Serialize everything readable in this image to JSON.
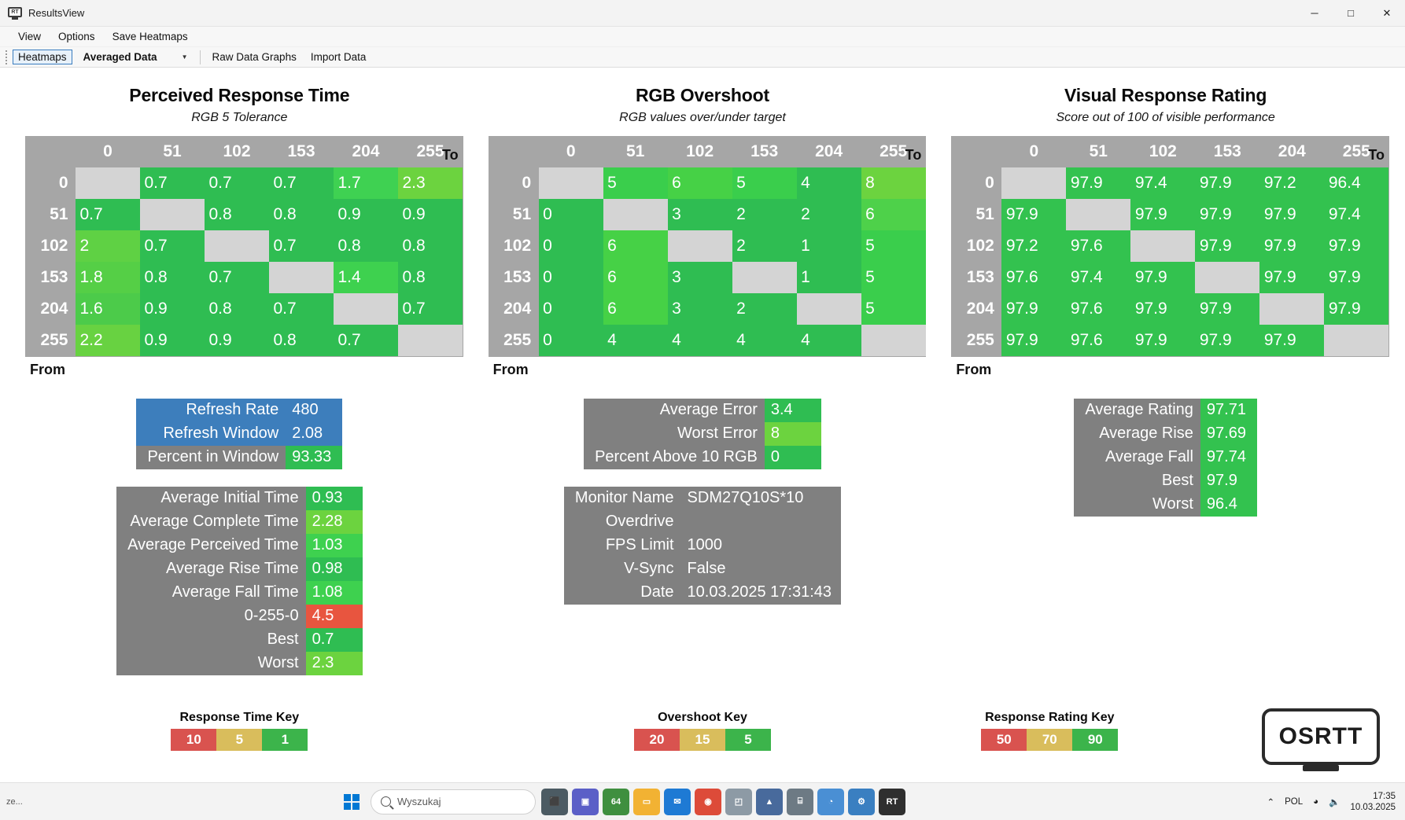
{
  "window": {
    "title": "ResultsView",
    "icon": "monitor-rt-icon",
    "minimize": "─",
    "maximize": "□",
    "close": "✕"
  },
  "menubar": {
    "items": [
      {
        "label": "View"
      },
      {
        "label": "Options"
      },
      {
        "label": "Save Heatmaps"
      }
    ]
  },
  "toolbar": {
    "heatmaps_label": "Heatmaps",
    "dataset_selected": "Averaged Data",
    "dataset_caret": "▼",
    "raw_data_graphs_label": "Raw Data Graphs",
    "import_data_label": "Import Data"
  },
  "axis": {
    "to": "To",
    "from": "From"
  },
  "chart_data": [
    {
      "type": "heatmap",
      "title": "Perceived Response Time",
      "subtitle": "RGB 5 Tolerance",
      "xlabel": "To",
      "ylabel": "From",
      "categories": [
        "0",
        "51",
        "102",
        "153",
        "204",
        "255"
      ],
      "rows": [
        "0",
        "51",
        "102",
        "153",
        "204",
        "255"
      ],
      "values": [
        [
          null,
          "0.7",
          "0.7",
          "0.7",
          "1.7",
          "2.3"
        ],
        [
          "0.7",
          null,
          "0.8",
          "0.8",
          "0.9",
          "0.9"
        ],
        [
          "2",
          "0.7",
          null,
          "0.7",
          "0.8",
          "0.8"
        ],
        [
          "1.8",
          "0.8",
          "0.7",
          null,
          "1.4",
          "0.8"
        ],
        [
          "1.6",
          "0.9",
          "0.8",
          "0.7",
          null,
          "0.7"
        ],
        [
          "2.2",
          "0.9",
          "0.9",
          "0.8",
          "0.7",
          null
        ]
      ],
      "colors": [
        [
          null,
          "#2fbd52",
          "#2fbd52",
          "#2fbd52",
          "#3fd152",
          "#6cd33f"
        ],
        [
          "#2fbd52",
          null,
          "#2fbd52",
          "#2fbd52",
          "#2fbd52",
          "#2fbd52"
        ],
        [
          "#5fd144",
          "#2fbd52",
          null,
          "#2fbd52",
          "#2fbd52",
          "#2fbd52"
        ],
        [
          "#55cf46",
          "#2fbd52",
          "#2fbd52",
          null,
          "#3ed14f",
          "#2fbd52"
        ],
        [
          "#4ccb4a",
          "#2fbd52",
          "#2fbd52",
          "#2fbd52",
          null,
          "#2fbd52"
        ],
        [
          "#68d241",
          "#2fbd52",
          "#2fbd52",
          "#2fbd52",
          "#2fbd52",
          null
        ]
      ]
    },
    {
      "type": "heatmap",
      "title": "RGB Overshoot",
      "subtitle": "RGB values over/under target",
      "xlabel": "To",
      "ylabel": "From",
      "categories": [
        "0",
        "51",
        "102",
        "153",
        "204",
        "255"
      ],
      "rows": [
        "0",
        "51",
        "102",
        "153",
        "204",
        "255"
      ],
      "values": [
        [
          null,
          "5",
          "6",
          "5",
          "4",
          "8"
        ],
        [
          "0",
          null,
          "3",
          "2",
          "2",
          "6"
        ],
        [
          "0",
          "6",
          null,
          "2",
          "1",
          "5"
        ],
        [
          "0",
          "6",
          "3",
          null,
          "1",
          "5"
        ],
        [
          "0",
          "6",
          "3",
          "2",
          null,
          "5"
        ],
        [
          "0",
          "4",
          "4",
          "4",
          "4",
          null
        ]
      ],
      "colors": [
        [
          null,
          "#3ace4c",
          "#46d146",
          "#3ace4c",
          "#2fbd52",
          "#6cd33f"
        ],
        [
          "#2fbd52",
          null,
          "#2fbd52",
          "#2fbd52",
          "#2fbd52",
          "#4ed14a"
        ],
        [
          "#2fbd52",
          "#46d146",
          null,
          "#2fbd52",
          "#2fbd52",
          "#3ace4c"
        ],
        [
          "#2fbd52",
          "#46d146",
          "#2fbd52",
          null,
          "#2fbd52",
          "#3ace4c"
        ],
        [
          "#2fbd52",
          "#46d146",
          "#2fbd52",
          "#2fbd52",
          null,
          "#3ace4c"
        ],
        [
          "#2fbd52",
          "#2fbd52",
          "#2fbd52",
          "#2fbd52",
          "#2fbd52",
          null
        ]
      ]
    },
    {
      "type": "heatmap",
      "title": "Visual Response Rating",
      "subtitle": "Score out of 100 of visible performance",
      "xlabel": "To",
      "ylabel": "From",
      "categories": [
        "0",
        "51",
        "102",
        "153",
        "204",
        "255"
      ],
      "rows": [
        "0",
        "51",
        "102",
        "153",
        "204",
        "255"
      ],
      "values": [
        [
          null,
          "97.9",
          "97.4",
          "97.9",
          "97.2",
          "96.4"
        ],
        [
          "97.9",
          null,
          "97.9",
          "97.9",
          "97.9",
          "97.4"
        ],
        [
          "97.2",
          "97.6",
          null,
          "97.9",
          "97.9",
          "97.9"
        ],
        [
          "97.6",
          "97.4",
          "97.9",
          null,
          "97.9",
          "97.9"
        ],
        [
          "97.9",
          "97.6",
          "97.9",
          "97.9",
          null,
          "97.9"
        ],
        [
          "97.9",
          "97.6",
          "97.9",
          "97.9",
          "97.9",
          null
        ]
      ],
      "colors": [
        [
          null,
          "#33c24f",
          "#33c24f",
          "#33c24f",
          "#33c24f",
          "#33c24f"
        ],
        [
          "#33c24f",
          null,
          "#33c24f",
          "#33c24f",
          "#33c24f",
          "#33c24f"
        ],
        [
          "#33c24f",
          "#33c24f",
          null,
          "#33c24f",
          "#33c24f",
          "#33c24f"
        ],
        [
          "#33c24f",
          "#33c24f",
          "#33c24f",
          null,
          "#33c24f",
          "#33c24f"
        ],
        [
          "#33c24f",
          "#33c24f",
          "#33c24f",
          "#33c24f",
          null,
          "#33c24f"
        ],
        [
          "#33c24f",
          "#33c24f",
          "#33c24f",
          "#33c24f",
          "#33c24f",
          null
        ]
      ]
    }
  ],
  "refresh_box": {
    "rows": [
      {
        "label": "Refresh Rate",
        "value": "480",
        "style": "blue"
      },
      {
        "label": "Refresh Window",
        "value": "2.08",
        "style": "blue"
      },
      {
        "label": "Percent in Window",
        "value": "93.33",
        "color": "#2fbd52"
      }
    ]
  },
  "response_box": {
    "rows": [
      {
        "label": "Average Initial Time",
        "value": "0.93",
        "color": "#2fbd52"
      },
      {
        "label": "Average Complete Time",
        "value": "2.28",
        "color": "#6cd33f"
      },
      {
        "label": "Average Perceived Time",
        "value": "1.03",
        "color": "#3ed14f"
      },
      {
        "label": "Average Rise Time",
        "value": "0.98",
        "color": "#2fbd52"
      },
      {
        "label": "Average Fall Time",
        "value": "1.08",
        "color": "#3ed14f"
      },
      {
        "label": "0-255-0",
        "value": "4.5",
        "color": "#e8553f"
      },
      {
        "label": "Best",
        "value": "0.7",
        "color": "#2fbd52"
      },
      {
        "label": "Worst",
        "value": "2.3",
        "color": "#6cd33f"
      }
    ]
  },
  "overshoot_box": {
    "rows": [
      {
        "label": "Average Error",
        "value": "3.4",
        "color": "#2fbd52"
      },
      {
        "label": "Worst Error",
        "value": "8",
        "color": "#6cd33f"
      },
      {
        "label": "Percent Above 10 RGB",
        "value": "0",
        "color": "#2fbd52"
      }
    ]
  },
  "monitor_box": {
    "rows": [
      {
        "label": "Monitor Name",
        "value": "SDM27Q10S*10"
      },
      {
        "label": "Overdrive",
        "value": ""
      },
      {
        "label": "FPS Limit",
        "value": "1000"
      },
      {
        "label": "V-Sync",
        "value": "False"
      },
      {
        "label": "Date",
        "value": "10.03.2025 17:31:43"
      }
    ]
  },
  "rating_box": {
    "rows": [
      {
        "label": "Average Rating",
        "value": "97.71",
        "color": "#33c24f"
      },
      {
        "label": "Average Rise",
        "value": "97.69",
        "color": "#33c24f"
      },
      {
        "label": "Average Fall",
        "value": "97.74",
        "color": "#33c24f"
      },
      {
        "label": "Best",
        "value": "97.9",
        "color": "#33c24f"
      },
      {
        "label": "Worst",
        "value": "96.4",
        "color": "#33c24f"
      }
    ]
  },
  "keys": [
    {
      "title": "Response Time Key",
      "cells": [
        {
          "label": "10",
          "color": "#d9534f"
        },
        {
          "label": "5",
          "color": "#d9bd5c"
        },
        {
          "label": "1",
          "color": "#3cb44b"
        }
      ]
    },
    {
      "title": "Overshoot Key",
      "cells": [
        {
          "label": "20",
          "color": "#d9534f"
        },
        {
          "label": "15",
          "color": "#d9bd5c"
        },
        {
          "label": "5",
          "color": "#3cb44b"
        }
      ]
    },
    {
      "title": "Response Rating Key",
      "cells": [
        {
          "label": "50",
          "color": "#d9534f"
        },
        {
          "label": "70",
          "color": "#d9bd5c"
        },
        {
          "label": "90",
          "color": "#3cb44b"
        }
      ]
    }
  ],
  "logo": {
    "text": "OSRTT"
  },
  "taskbar": {
    "left_text": "ze...",
    "search_placeholder": "Wyszukaj",
    "icons": [
      {
        "name": "task-view-icon",
        "glyph": "⬛",
        "color": "#4c5b63"
      },
      {
        "name": "teams-icon",
        "glyph": "▣",
        "color": "#5b5fc7"
      },
      {
        "name": "calculator64-icon",
        "glyph": "64",
        "color": "#3f8f3f"
      },
      {
        "name": "file-explorer-icon",
        "glyph": "▭",
        "color": "#f2b233"
      },
      {
        "name": "mail-icon",
        "glyph": "✉",
        "color": "#1e7ad4"
      },
      {
        "name": "chrome-icon",
        "glyph": "◉",
        "color": "#dd4b39"
      },
      {
        "name": "photos-icon",
        "glyph": "◰",
        "color": "#8d9aa5"
      },
      {
        "name": "editor-icon",
        "glyph": "▲",
        "color": "#486a9c"
      },
      {
        "name": "database-icon",
        "glyph": "⌸",
        "color": "#6d7a84"
      },
      {
        "name": "firefox-icon",
        "glyph": "◔",
        "color": "#4a8fd4"
      },
      {
        "name": "settings-icon",
        "glyph": "⚙",
        "color": "#3a7fc1"
      },
      {
        "name": "osrtt-app-icon",
        "glyph": "RT",
        "color": "#2f2f2f"
      }
    ],
    "chevron": "⌃",
    "language": "POL",
    "wifi_icon": "wifi-icon",
    "volume_icon": "volume-icon",
    "time": "17:35",
    "date": "10.03.2025"
  }
}
